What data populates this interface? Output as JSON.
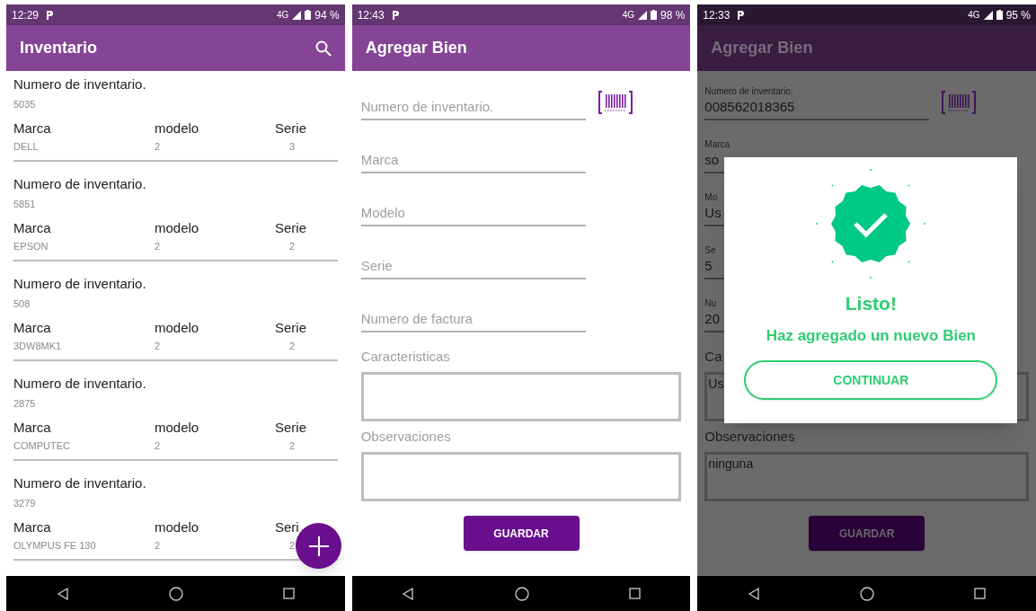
{
  "screens": [
    {
      "kind": "list",
      "dimmed": false,
      "status": {
        "time": "12:29",
        "network": "4G",
        "battery": "94 %"
      },
      "title": "Inventario",
      "search": true,
      "items": [
        {
          "heading": "Numero de inventario.",
          "number": "5035",
          "columns": [
            "Marca",
            "modelo",
            "Serie"
          ],
          "values": [
            "DELL",
            "2",
            "3"
          ]
        },
        {
          "heading": "Numero de inventario.",
          "number": "5851",
          "columns": [
            "Marca",
            "modelo",
            "Serie"
          ],
          "values": [
            "EPSON",
            "2",
            "2"
          ]
        },
        {
          "heading": "Numero de inventario.",
          "number": "508",
          "columns": [
            "Marca",
            "modelo",
            "Serie"
          ],
          "values": [
            "3DW8MK1",
            "2",
            "2"
          ]
        },
        {
          "heading": "Numero de inventario.",
          "number": "2875",
          "columns": [
            "Marca",
            "modelo",
            "Serie"
          ],
          "values": [
            "COMPUTEC",
            "2",
            "2"
          ]
        },
        {
          "heading": "Numero de inventario.",
          "number": "3279",
          "columns": [
            "Marca",
            "modelo",
            "Seri"
          ],
          "values": [
            "OLYMPUS FE 130",
            "2",
            "2"
          ]
        }
      ],
      "fab": true
    },
    {
      "kind": "form",
      "dimmed": false,
      "status": {
        "time": "12:43",
        "network": "4G",
        "battery": "98 %"
      },
      "title": "Agregar Bien",
      "fields": [
        {
          "kind": "line",
          "placeholder": "Numero de inventario.",
          "scan": true
        },
        {
          "kind": "line",
          "placeholder": "Marca"
        },
        {
          "kind": "line",
          "placeholder": "Modelo"
        },
        {
          "kind": "line",
          "placeholder": "Serie"
        },
        {
          "kind": "line",
          "placeholder": "Numero de factura"
        },
        {
          "kind": "area",
          "label": "Caracteristicas"
        },
        {
          "kind": "area",
          "label": "Observaciones"
        }
      ],
      "button": "GUARDAR"
    },
    {
      "kind": "form",
      "dimmed": true,
      "status": {
        "time": "12:33",
        "network": "4G",
        "battery": "95 %"
      },
      "title": "Agregar Bien",
      "fields": [
        {
          "kind": "line",
          "label": "Numero de inventario.",
          "value": "008562018365",
          "scan": true
        },
        {
          "kind": "line",
          "label": "Marca",
          "value": "so"
        },
        {
          "kind": "line",
          "label": "Mo",
          "value": "Us"
        },
        {
          "kind": "line",
          "label": "Se",
          "value": "5"
        },
        {
          "kind": "line",
          "label": "Nu",
          "value": "20"
        },
        {
          "kind": "area",
          "label": "Ca",
          "value": "Us"
        },
        {
          "kind": "area",
          "label": "Observaciones",
          "value": "ninguna"
        }
      ],
      "button": "GUARDAR",
      "dialog": {
        "title": "Listo!",
        "message": "Haz agregado un nuevo Bien",
        "button": "CONTINUAR"
      }
    }
  ]
}
